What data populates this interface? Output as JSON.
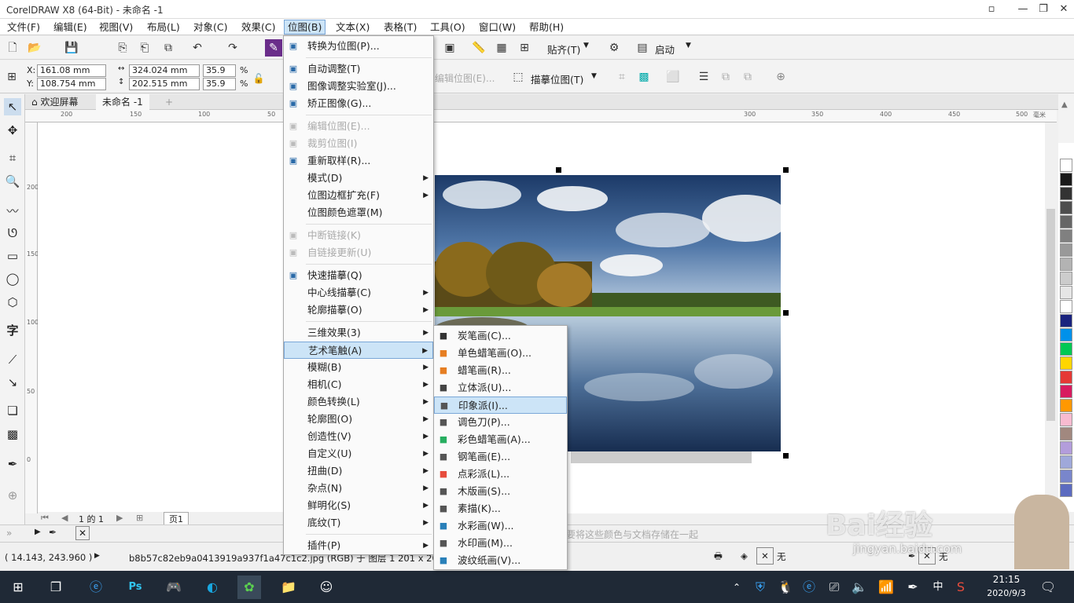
{
  "window": {
    "title": "CorelDRAW X8 (64-Bit) - 未命名 -1"
  },
  "menubar": [
    "文件(F)",
    "编辑(E)",
    "视图(V)",
    "布局(L)",
    "对象(C)",
    "效果(C)",
    "位图(B)",
    "文本(X)",
    "表格(T)",
    "工具(O)",
    "窗口(W)",
    "帮助(H)"
  ],
  "toolbar": {
    "snap_label": "贴齐(T)",
    "launch_label": "启动"
  },
  "props": {
    "x": "161.08 mm",
    "y": "108.754 mm",
    "w": "324.024 mm",
    "h": "202.515 mm",
    "sx": "35.9",
    "sy": "35.9",
    "pct": "%",
    "x_label": "X:",
    "y_label": "Y:",
    "edit_bitmap": "编辑位图(E)...",
    "trace_bitmap": "描摹位图(T)"
  },
  "doctabs": {
    "welcome": "欢迎屏幕",
    "doc": "未命名 -1"
  },
  "ruler": {
    "h_left": [
      "200",
      "150",
      "100",
      "50"
    ],
    "h_right": [
      "300",
      "350",
      "400",
      "450",
      "500"
    ],
    "unit": "毫米",
    "v": [
      "200",
      "150",
      "100",
      "50",
      "0"
    ]
  },
  "pagebar": {
    "pages": "1 的 1",
    "page_tab": "页1"
  },
  "bottom": {
    "palette_hint": "要将这些颜色与文档存储在一起"
  },
  "status": {
    "coords": "( 14.143, 243.960 )",
    "file": "b8b57c82eb9a0413919a937f1a47c1c2.jpg (RGB) 于 图层 1 201 x 201 dpi",
    "fill_none": "无",
    "outline_none": "无"
  },
  "palette_colors": [
    "#ffffff",
    "#1a1a1a",
    "#333333",
    "#4d4d4d",
    "#666666",
    "#808080",
    "#999999",
    "#b3b3b3",
    "#cccccc",
    "#e6e6e6",
    "#ffffff",
    "#1a237e",
    "#0091ea",
    "#00c853",
    "#ffd600",
    "#e53935",
    "#d81b60",
    "#ff9800",
    "#f8bbd0",
    "#a1887f",
    "#b39ddb",
    "#9fa8da",
    "#7986cb",
    "#5c6bc0"
  ],
  "bitmap_menu": {
    "items": [
      {
        "label": "转换为位图(P)...",
        "icon": "convert-bitmap-icon",
        "state": "normal"
      },
      {
        "sep": true
      },
      {
        "label": "自动调整(T)",
        "icon": "auto-adjust-icon",
        "state": "normal"
      },
      {
        "label": "图像调整实验室(J)...",
        "icon": "image-lab-icon",
        "state": "normal"
      },
      {
        "label": "矫正图像(G)...",
        "icon": "straighten-icon",
        "state": "normal"
      },
      {
        "sep": true
      },
      {
        "label": "编辑位图(E)...",
        "icon": "edit-bitmap-icon",
        "state": "disabled"
      },
      {
        "label": "裁剪位图(I)",
        "icon": "crop-bitmap-icon",
        "state": "disabled"
      },
      {
        "label": "重新取样(R)...",
        "icon": "resample-icon",
        "state": "normal"
      },
      {
        "label": "模式(D)",
        "state": "normal",
        "sub": true
      },
      {
        "label": "位图边框扩充(F)",
        "state": "normal",
        "sub": true
      },
      {
        "label": "位图颜色遮罩(M)",
        "state": "normal"
      },
      {
        "sep": true
      },
      {
        "label": "中断链接(K)",
        "icon": "break-link-icon",
        "state": "disabled"
      },
      {
        "label": "自链接更新(U)",
        "icon": "update-link-icon",
        "state": "disabled"
      },
      {
        "sep": true
      },
      {
        "label": "快速描摹(Q)",
        "icon": "quick-trace-icon",
        "state": "normal"
      },
      {
        "label": "中心线描摹(C)",
        "state": "normal",
        "sub": true
      },
      {
        "label": "轮廓描摹(O)",
        "state": "normal",
        "sub": true
      },
      {
        "sep": true
      },
      {
        "label": "三维效果(3)",
        "state": "normal",
        "sub": true
      },
      {
        "label": "艺术笔触(A)",
        "state": "highlight",
        "sub": true
      },
      {
        "label": "模糊(B)",
        "state": "normal",
        "sub": true
      },
      {
        "label": "相机(C)",
        "state": "normal",
        "sub": true
      },
      {
        "label": "颜色转换(L)",
        "state": "normal",
        "sub": true
      },
      {
        "label": "轮廓图(O)",
        "state": "normal",
        "sub": true
      },
      {
        "label": "创造性(V)",
        "state": "normal",
        "sub": true
      },
      {
        "label": "自定义(U)",
        "state": "normal",
        "sub": true
      },
      {
        "label": "扭曲(D)",
        "state": "normal",
        "sub": true
      },
      {
        "label": "杂点(N)",
        "state": "normal",
        "sub": true
      },
      {
        "label": "鲜明化(S)",
        "state": "normal",
        "sub": true
      },
      {
        "label": "底纹(T)",
        "state": "normal",
        "sub": true
      },
      {
        "sep": true
      },
      {
        "label": "插件(P)",
        "state": "normal",
        "sub": true
      }
    ]
  },
  "art_menu": {
    "items": [
      {
        "label": "炭笔画(C)...",
        "icon": "charcoal-icon",
        "color": "#333333"
      },
      {
        "label": "单色蜡笔画(O)...",
        "icon": "conte-crayon-icon",
        "color": "#e67e22"
      },
      {
        "label": "蜡笔画(R)...",
        "icon": "crayon-icon",
        "color": "#e67e22"
      },
      {
        "label": "立体派(U)...",
        "icon": "cubist-icon",
        "color": "#444444"
      },
      {
        "label": "印象派(I)...",
        "icon": "impressionist-icon",
        "color": "#555555",
        "hl": true
      },
      {
        "label": "调色刀(P)...",
        "icon": "palette-knife-icon",
        "color": "#555555"
      },
      {
        "label": "彩色蜡笔画(A)...",
        "icon": "pastels-icon",
        "color": "#27ae60"
      },
      {
        "label": "钢笔画(E)...",
        "icon": "pen-ink-icon",
        "color": "#555555"
      },
      {
        "label": "点彩派(L)...",
        "icon": "pointillist-icon",
        "color": "#e74c3c"
      },
      {
        "label": "木版画(S)...",
        "icon": "scraperboard-icon",
        "color": "#555555"
      },
      {
        "label": "素描(K)...",
        "icon": "sketch-pad-icon",
        "color": "#555555"
      },
      {
        "label": "水彩画(W)...",
        "icon": "watercolor-icon",
        "color": "#2980b9"
      },
      {
        "label": "水印画(M)...",
        "icon": "water-marker-icon",
        "color": "#555555"
      },
      {
        "label": "波纹纸画(V)...",
        "icon": "wavy-paper-icon",
        "color": "#2980b9"
      }
    ]
  },
  "taskbar": {
    "time": "21:15",
    "date": "2020/9/3",
    "ime": "中"
  },
  "watermark": {
    "text": "Bai经验",
    "url": "jingyan.baidu.com"
  }
}
